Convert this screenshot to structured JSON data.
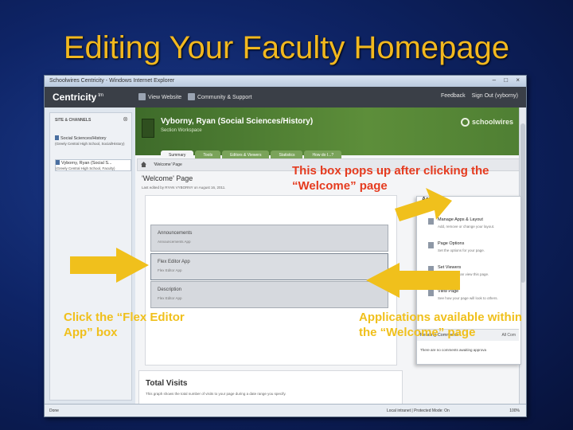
{
  "slide": {
    "title": "Editing Your Faculty Homepage"
  },
  "browser": {
    "window_title": "Schoolwires Centricity - Windows Internet Explorer",
    "window_buttons": "– □ ×",
    "status_left": "Done",
    "status_zone": "Local intranet | Protected Mode: On",
    "status_zoom": "100%"
  },
  "app": {
    "brand": "Centricity",
    "brand_mark": "tm",
    "view_website": "View Website",
    "community_support": "Community & Support",
    "feedback": "Feedback",
    "sign_out": "Sign Out (vyborny)"
  },
  "sidebar": {
    "title": "SITE & CHANNELS",
    "close": "⊗",
    "sites": [
      {
        "name": "Social Sciences/History",
        "sub": "(Greely Central High School, Social/History)"
      },
      {
        "name": "Vyborny, Ryan (Social S...",
        "sub": "(Greely Central High School, Faculty)"
      }
    ]
  },
  "workspace": {
    "owner": "Vyborny, Ryan (Social Sciences/History)",
    "label": "Section Workspace",
    "logo": "schoolwires",
    "tabs": [
      "Summary",
      "Tools",
      "Editors & Viewers",
      "Statistics",
      "How do I...?"
    ],
    "breadcrumb": "'Welcome' Page",
    "page_heading": "'Welcome' Page",
    "last_edited": "Last edited by RYAN VYBORNY on August 16, 2011."
  },
  "apps": [
    {
      "title": "Announcements",
      "sub": "Announcements App"
    },
    {
      "title": "Flex Editor App",
      "sub": "Flex Editor App"
    },
    {
      "title": "Description",
      "sub": "Flex Editor App"
    }
  ],
  "visits": {
    "title": "Total Visits",
    "sub": "This graph shows the total number of visits to your page during a date range you specify."
  },
  "actions": {
    "title": "Acti",
    "items": [
      {
        "title": "Manage Apps & Layout",
        "sub": "Add, remove or change your layout."
      },
      {
        "title": "Page Options",
        "sub": "Set the options for your page."
      },
      {
        "title": "Set Viewers",
        "sub": "Restrict who can view this page."
      },
      {
        "title": "View Page",
        "sub": "See how your page will look to others."
      }
    ],
    "pending_title": "Pending Comments",
    "pending_all": "All Com",
    "pending_body": "There are no comments awaiting approva"
  },
  "annotations": {
    "popup_note": "This box pops up after clicking the “Welcome” page",
    "flex_note": "Click the “Flex Editor App” box",
    "apps_note": "Applications available within the “Welcome” page",
    "popup_color": "#e53b1f",
    "note_color": "#f0c01c"
  }
}
